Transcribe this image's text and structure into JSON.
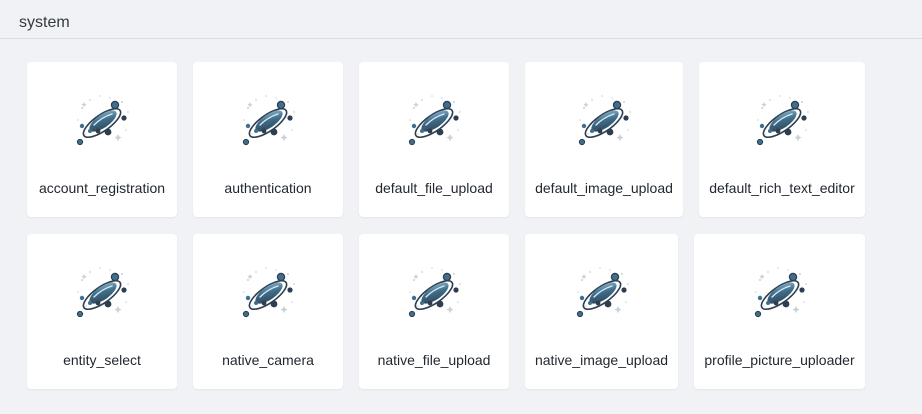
{
  "section": {
    "title": "system"
  },
  "icon": "planet-orbit-icon",
  "colors": {
    "background": "#f0f2f5",
    "card": "#ffffff",
    "icon_primary": "#3f6f8c",
    "icon_dark": "#2c3e50"
  },
  "cards": [
    {
      "label": "account_registration"
    },
    {
      "label": "authentication"
    },
    {
      "label": "default_file_upload"
    },
    {
      "label": "default_image_upload"
    },
    {
      "label": "default_rich_text_editor"
    },
    {
      "label": "entity_select"
    },
    {
      "label": "native_camera"
    },
    {
      "label": "native_file_upload"
    },
    {
      "label": "native_image_upload"
    },
    {
      "label": "profile_picture_uploader"
    }
  ]
}
